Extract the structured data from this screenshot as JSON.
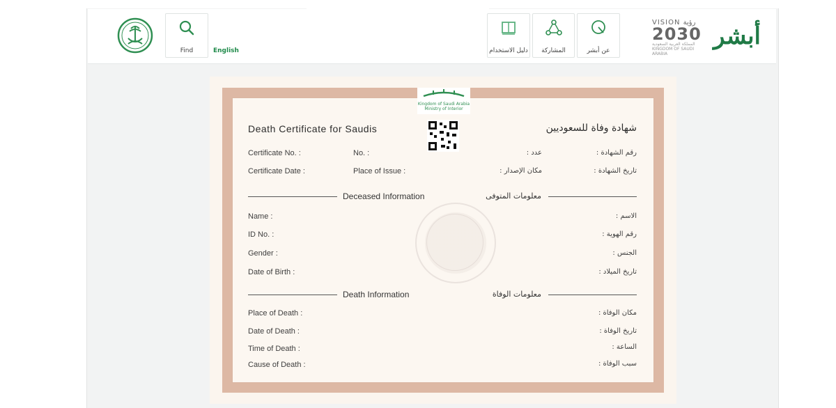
{
  "header": {
    "lang_label": "English",
    "search_tile_label": "Find",
    "tiles": [
      {
        "label": "دليل الاستخدام"
      },
      {
        "label": "المشاركة"
      },
      {
        "label": "عن أبشر"
      }
    ],
    "vision": {
      "head": "VISION رؤية",
      "year": "2030",
      "sub": "المملكة العربية السعودية KINGDOM OF SAUDI ARABIA"
    },
    "absher_logo": "أبشر"
  },
  "certificate": {
    "kingdom_logo_en": "Kingdom of Saudi Arabia",
    "kingdom_logo_sub": "Ministry of Interior",
    "title_en": "Death Certificate for Saudis",
    "title_ar": "شهادة وفاة للسعوديين",
    "row1": {
      "en_left": "Certificate No. :",
      "en_mid": "No. :",
      "ar_mid": "عدد :",
      "ar_right": "رقم الشهادة :"
    },
    "row2": {
      "en_left": "Certificate Date :",
      "en_mid": "Place of Issue :",
      "ar_mid": "مكان الإصدار :",
      "ar_right": "تاريخ الشهادة :"
    },
    "deceased": {
      "title_en": "Deceased Information",
      "title_ar": "معلومات المتوفى",
      "fields": [
        {
          "en": "Name :",
          "ar": "الاسم :"
        },
        {
          "en": "ID No. :",
          "ar": "رقم الهوية :"
        },
        {
          "en": "Gender :",
          "ar": "الجنس :"
        },
        {
          "en": "Date of Birth :",
          "ar": "تاريخ الميلاد :"
        }
      ]
    },
    "death": {
      "title_en": "Death Information",
      "title_ar": "معلومات الوفاة",
      "fields": [
        {
          "en": "Place of Death :",
          "ar": "مكان الوفاة :"
        },
        {
          "en": "Date of Death :",
          "ar": "تاريخ الوفاة :"
        },
        {
          "en": "Time of Death :",
          "ar": "الساعة :"
        },
        {
          "en": "Cause of Death :",
          "ar": "سبب الوفاة :"
        }
      ]
    }
  },
  "colors": {
    "brand_green": "#1f7a46",
    "cert_border": "#ddb8a4",
    "cert_bg": "#fcf7f1"
  }
}
